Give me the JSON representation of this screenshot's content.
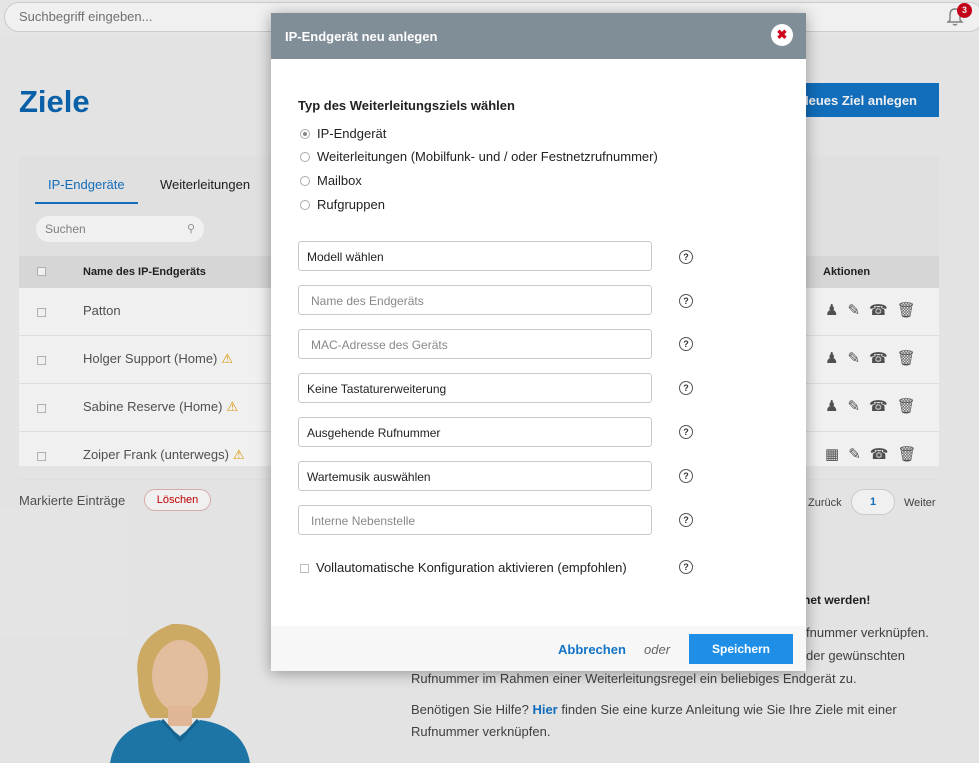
{
  "topbar": {
    "search_placeholder": "Suchbegriff eingeben...",
    "notification_count": "3"
  },
  "page": {
    "title": "Ziele",
    "new_button": "Neues Ziel anlegen"
  },
  "list": {
    "tabs": [
      {
        "label": "IP-Endgeräte",
        "active": true
      },
      {
        "label": "Weiterleitungen",
        "active": false
      }
    ],
    "search_placeholder": "Suchen",
    "columns": {
      "name": "Name des IP-Endgeräts",
      "actions": "Aktionen"
    },
    "rows": [
      {
        "name": "Patton",
        "warning": false
      },
      {
        "name": "Holger Support (Home)",
        "warning": true
      },
      {
        "name": "Sabine Reserve (Home)",
        "warning": true
      },
      {
        "name": "Zoiper Frank (unterwegs)",
        "warning": true
      }
    ],
    "marked_label": "Markierte Einträge",
    "delete_button": "Löschen",
    "pager": {
      "back": "Zurück",
      "page": "1",
      "next": "Weiter"
    }
  },
  "info": {
    "title_fragment": "net werden!",
    "line1_fragment": "fnummer verknüpfen.",
    "line2_fragment": "der gewünschten",
    "line3": "Rufnummer im Rahmen einer Weiterleitungsregel ein beliebiges Endgerät zu.",
    "line4_pre": "Benötigen Sie Hilfe?",
    "line4_link": "Hier",
    "line4_post": "finden Sie eine kurze Anleitung wie Sie Ihre Ziele mit einer",
    "line5": "Rufnummer verknüpfen."
  },
  "modal": {
    "title": "IP-Endgerät neu anlegen",
    "section_label": "Typ des Weiterleitungsziels wählen",
    "radio_options": [
      {
        "label": "IP-Endgerät",
        "checked": true
      },
      {
        "label": "Weiterleitungen (Mobilfunk- und / oder Festnetzrufnummer)",
        "checked": false
      },
      {
        "label": "Mailbox",
        "checked": false
      },
      {
        "label": "Rufgruppen",
        "checked": false
      }
    ],
    "fields": {
      "model": "Modell wählen",
      "device_name_placeholder": "Name des Endgeräts",
      "mac_placeholder": "MAC-Adresse des Geräts",
      "keypad": "Keine Tastaturerweiterung",
      "outgoing": "Ausgehende Rufnummer",
      "hold_music": "Wartemusik auswählen",
      "extension_placeholder": "Interne Nebenstelle"
    },
    "help_symbol": "?",
    "auto_config_label": "Vollautomatische Konfiguration aktivieren (empfohlen)",
    "cancel": "Abbrechen",
    "or": "oder",
    "save": "Speichern"
  },
  "colors": {
    "accent": "#1474c6",
    "modal_header": "#808e98",
    "danger": "#d0021b",
    "warning": "#e6a100"
  }
}
